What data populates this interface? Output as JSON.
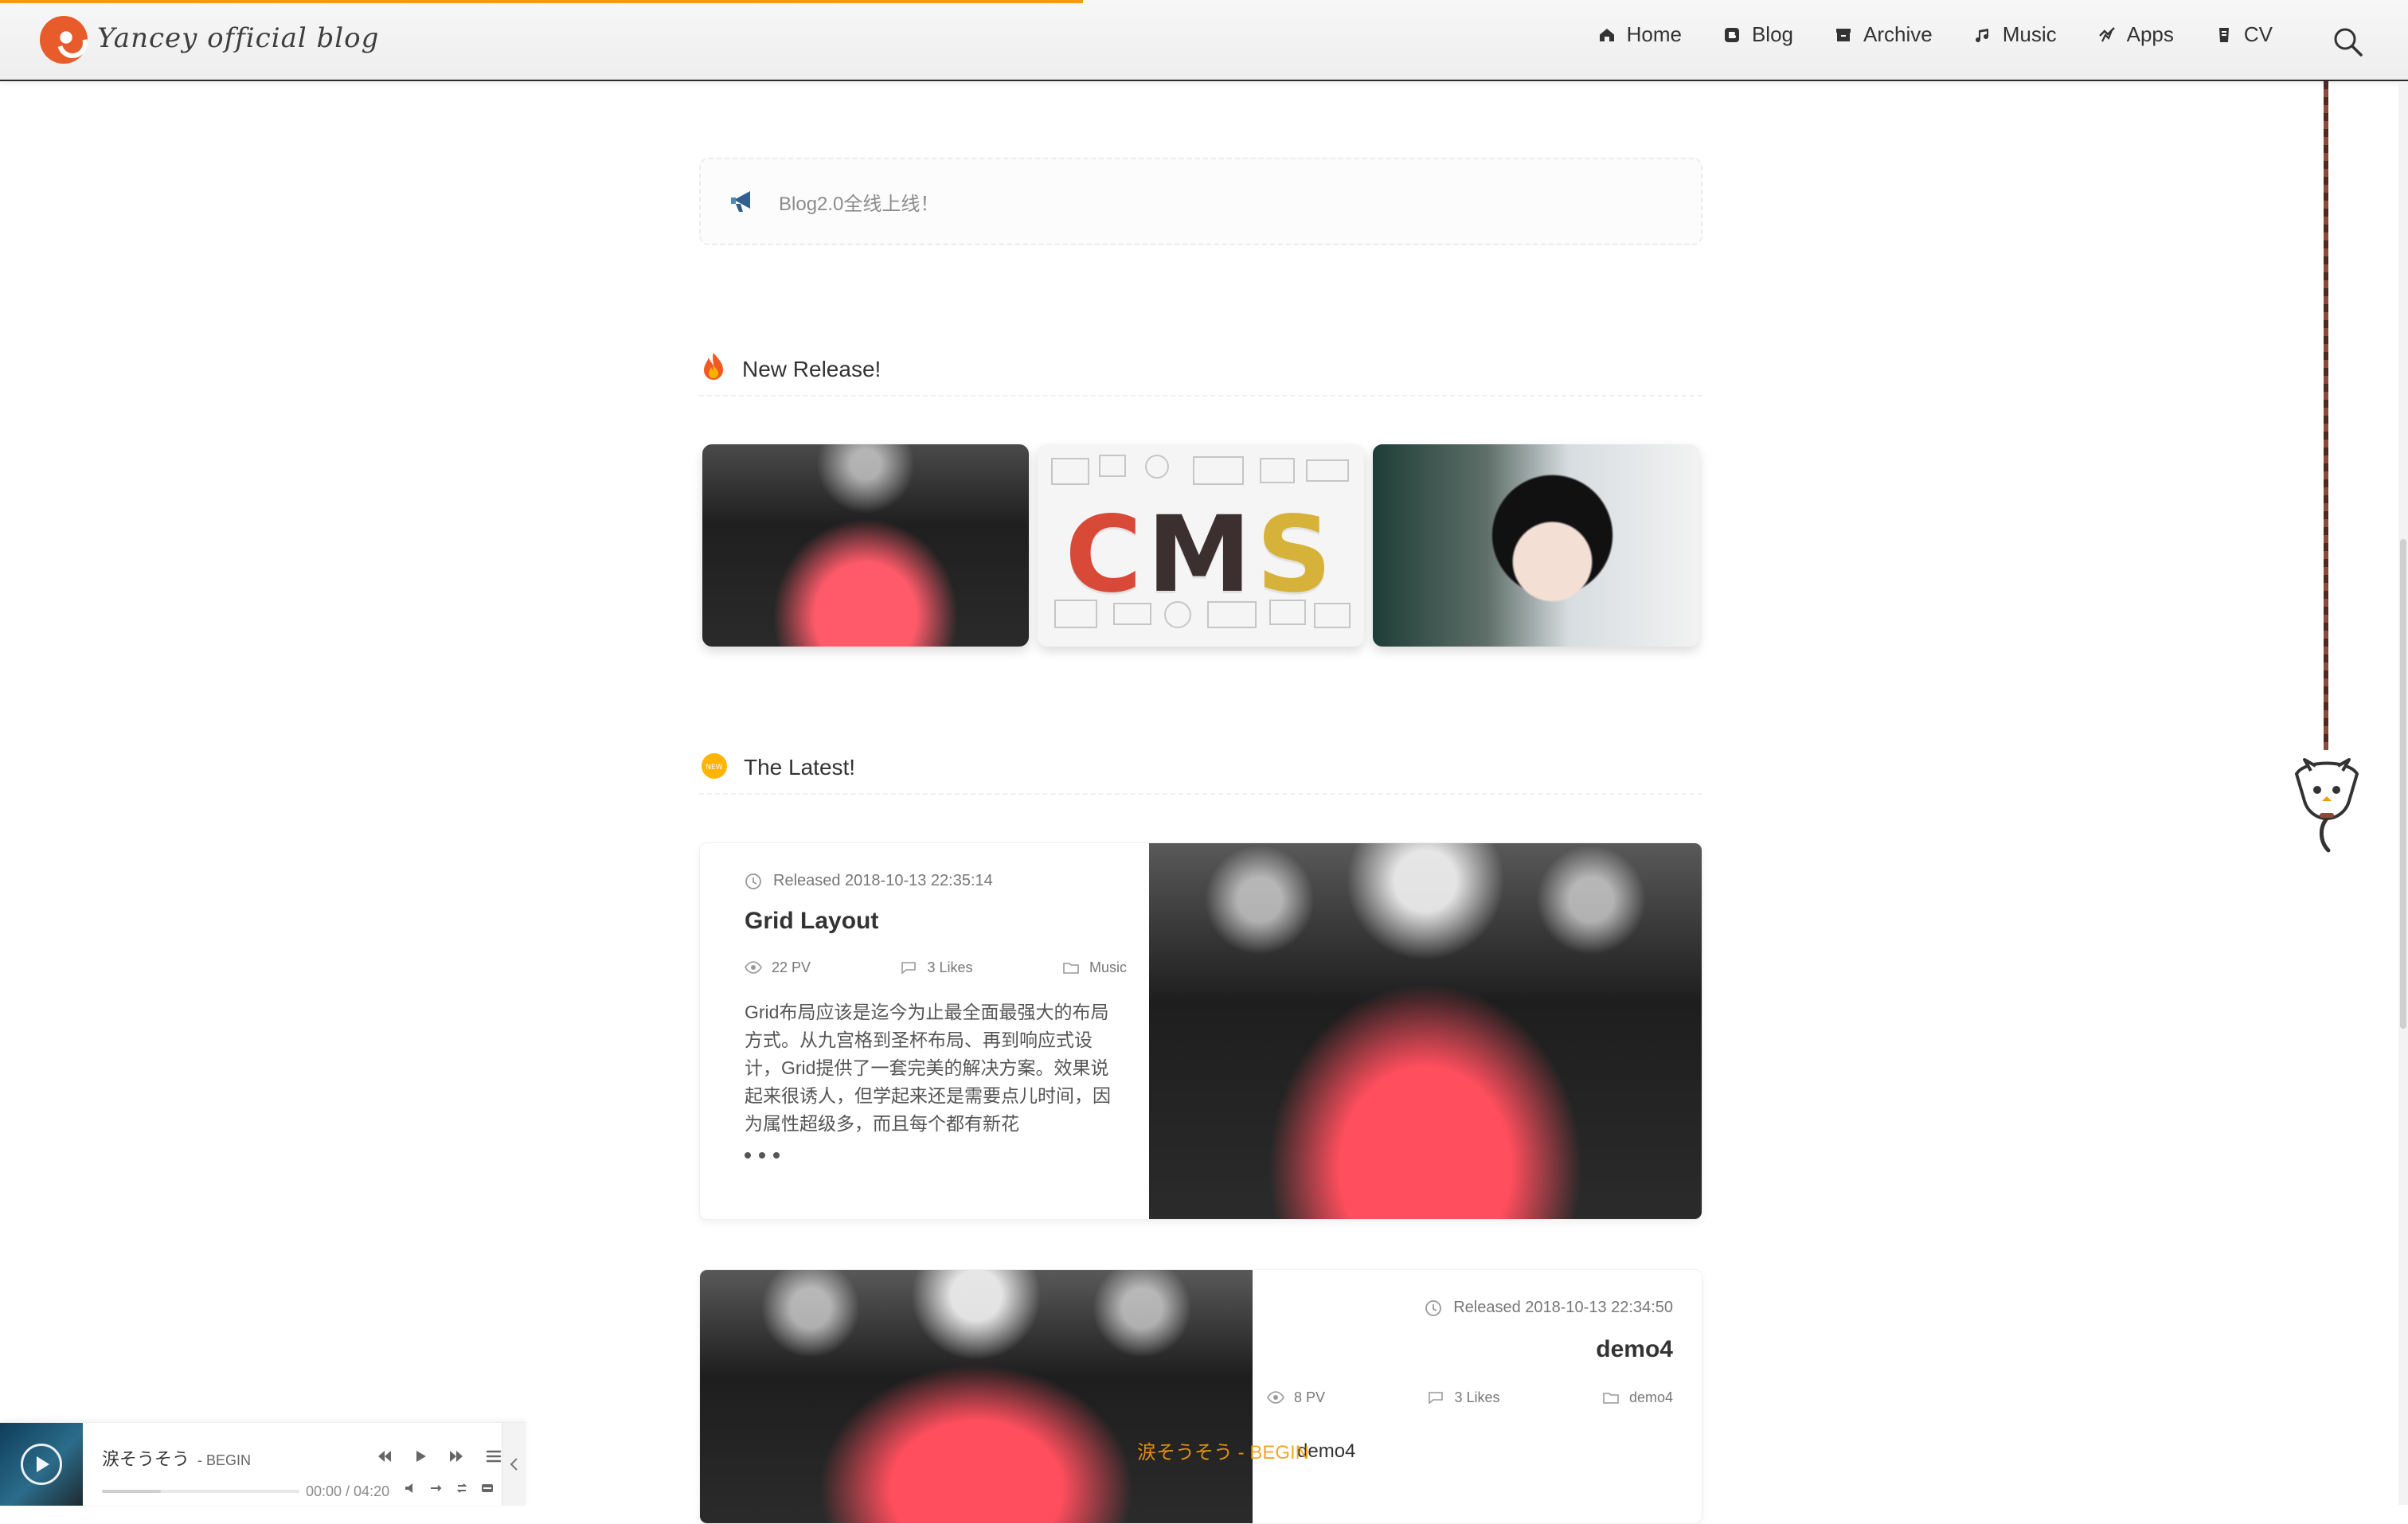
{
  "header": {
    "brand_title": "Yancey official blog",
    "nav": [
      {
        "label": "Home",
        "icon": "home-icon"
      },
      {
        "label": "Blog",
        "icon": "blog-icon"
      },
      {
        "label": "Archive",
        "icon": "archive-icon"
      },
      {
        "label": "Music",
        "icon": "music-icon"
      },
      {
        "label": "Apps",
        "icon": "apps-icon"
      },
      {
        "label": "CV",
        "icon": "cv-icon"
      }
    ],
    "search_icon": "search-icon",
    "accent": "#f39c12"
  },
  "notice": {
    "text": "Blog2.0全线上线！",
    "icon": "megaphone-icon"
  },
  "sections": {
    "new_release": {
      "title": "New Release!",
      "icon": "fire-icon"
    },
    "latest": {
      "title": "The Latest!",
      "icon": "new-badge-icon"
    }
  },
  "cards": [
    {
      "image": "concert-image"
    },
    {
      "image": "cms-image",
      "word": "CMS"
    },
    {
      "image": "portrait-image"
    }
  ],
  "posts": [
    {
      "released": "Released 2018-10-13 22:35:14",
      "title": "Grid Layout",
      "pv": "22 PV",
      "likes": "3 Likes",
      "category": "Music",
      "excerpt": "Grid布局应该是迄今为止最全面最强大的布局方式。从九宫格到圣杯布局、再到响应式设计，Grid提供了一套完美的解决方案。效果说起来很诱人，但学起来还是需要点儿时间，因为属性超级多，而且每个都有新花"
    },
    {
      "released": "Released 2018-10-13 22:34:50",
      "title": "demo4",
      "pv": "8 PV",
      "likes": "3 Likes",
      "category": "demo4",
      "subtitle": "demo4"
    }
  ],
  "player": {
    "song": "涙そうそう",
    "artist": "- BEGIN",
    "time": "00:00 / 04:20",
    "progress": 0.3
  },
  "overlay": {
    "lyric": "涙そうそう - BEGIN"
  }
}
